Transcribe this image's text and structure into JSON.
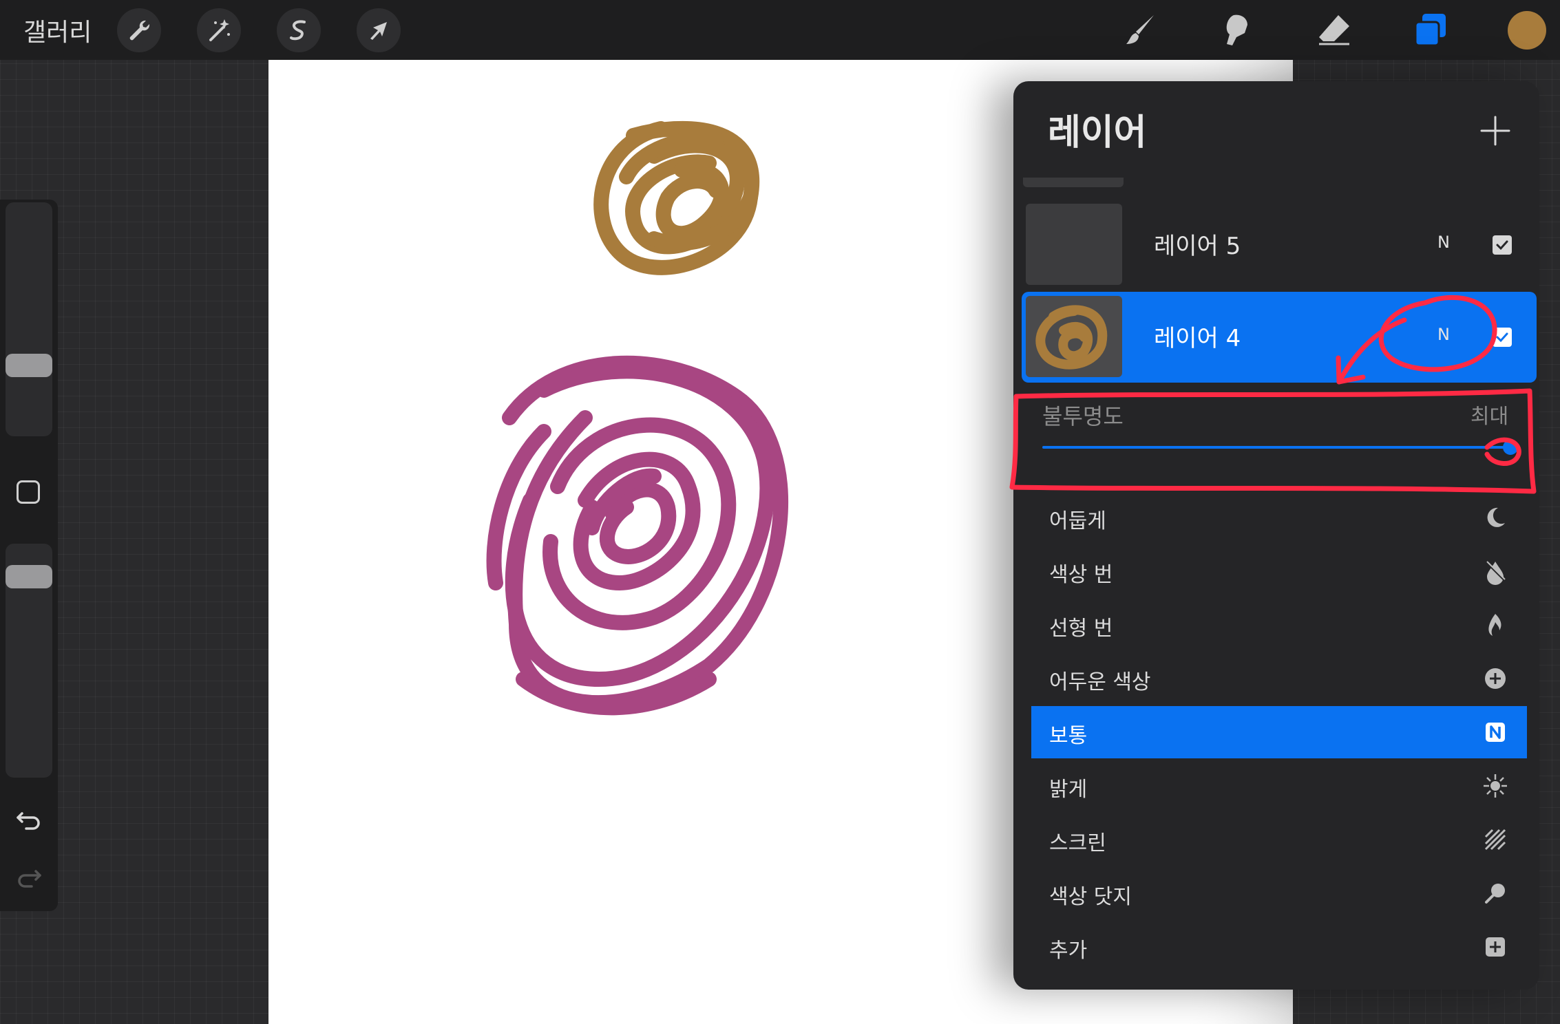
{
  "topbar": {
    "gallery_label": "갤러리",
    "left_tools": [
      {
        "name": "actions-wrench-icon"
      },
      {
        "name": "adjustments-magic-wand-icon"
      },
      {
        "name": "selection-s-icon"
      },
      {
        "name": "transform-arrow-icon"
      }
    ],
    "right_tools": [
      {
        "name": "brush-icon"
      },
      {
        "name": "smudge-icon"
      },
      {
        "name": "eraser-icon"
      },
      {
        "name": "layers-icon",
        "active": true
      }
    ],
    "current_color": "#a87c3c"
  },
  "sidebar": {
    "brush_size_level": 0.28,
    "brush_opacity_level": 0.9
  },
  "canvas": {
    "strokes": [
      {
        "name": "gold-scribble",
        "color": "#a87c3c"
      },
      {
        "name": "magenta-scribble",
        "color": "#a84682"
      }
    ]
  },
  "layers_panel": {
    "title": "레이어",
    "layers": [
      {
        "name": "레이어 5",
        "blend": "N",
        "visible": true,
        "selected": false
      },
      {
        "name": "레이어 4",
        "blend": "N",
        "visible": true,
        "selected": true
      }
    ],
    "opacity": {
      "label": "불투명도",
      "value_label": "최대",
      "value": 1.0
    },
    "blend_modes": [
      {
        "label": "어둡게",
        "icon": "moon-icon",
        "selected": false
      },
      {
        "label": "색상 번",
        "icon": "burn-drop-icon",
        "selected": false
      },
      {
        "label": "선형 번",
        "icon": "flame-icon",
        "selected": false
      },
      {
        "label": "어두운 색상",
        "icon": "plus-circle-icon",
        "selected": false
      },
      {
        "label": "보통",
        "icon": "n-box-icon",
        "selected": true
      },
      {
        "label": "밝게",
        "icon": "sun-icon",
        "selected": false
      },
      {
        "label": "스크린",
        "icon": "hatched-square-icon",
        "selected": false
      },
      {
        "label": "색상 닷지",
        "icon": "dodge-icon",
        "selected": false
      },
      {
        "label": "추가",
        "icon": "plus-box-icon",
        "selected": false
      }
    ]
  },
  "colors": {
    "accent": "#0a72f1",
    "annotation": "#ff2a44"
  }
}
